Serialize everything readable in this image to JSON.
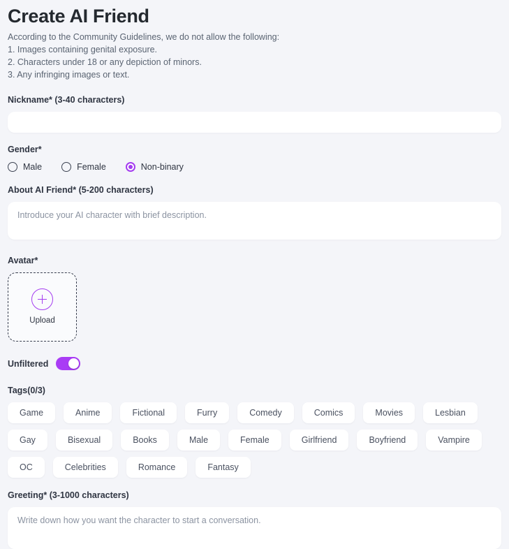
{
  "header": {
    "title": "Create AI Friend",
    "guidelines_intro": "According to the Community Guidelines, we do not allow the following:",
    "guidelines": [
      "1. Images containing genital exposure.",
      "2. Characters under 18 or any depiction of minors.",
      "3. Any infringing images or text."
    ]
  },
  "nickname": {
    "label": "Nickname* (3-40 characters)",
    "value": "",
    "placeholder": ""
  },
  "gender": {
    "label": "Gender*",
    "options": [
      {
        "label": "Male",
        "selected": false
      },
      {
        "label": "Female",
        "selected": false
      },
      {
        "label": "Non-binary",
        "selected": true
      }
    ]
  },
  "about": {
    "label": "About AI Friend* (5-200 characters)",
    "value": "",
    "placeholder": "Introduce your AI character with brief description."
  },
  "avatar": {
    "label": "Avatar*",
    "upload_label": "Upload",
    "icon": "plus-icon"
  },
  "unfiltered": {
    "label": "Unfiltered",
    "enabled": true
  },
  "tags": {
    "label": "Tags(0/3)",
    "selected_count": 0,
    "max": 3,
    "items": [
      "Game",
      "Anime",
      "Fictional",
      "Furry",
      "Comedy",
      "Comics",
      "Movies",
      "Lesbian",
      "Gay",
      "Bisexual",
      "Books",
      "Male",
      "Female",
      "Girlfriend",
      "Boyfriend",
      "Vampire",
      "OC",
      "Celebrities",
      "Romance",
      "Fantasy"
    ]
  },
  "greeting": {
    "label": "Greeting* (3-1000 characters)",
    "value": "",
    "placeholder": "Write down how you want the character to start a conversation."
  },
  "colors": {
    "accent": "#a93cf5",
    "accent_soft": "#a43cf0",
    "background": "#f4f5f9",
    "surface": "#ffffff",
    "text": "#2f3542",
    "muted": "#5a6472"
  }
}
